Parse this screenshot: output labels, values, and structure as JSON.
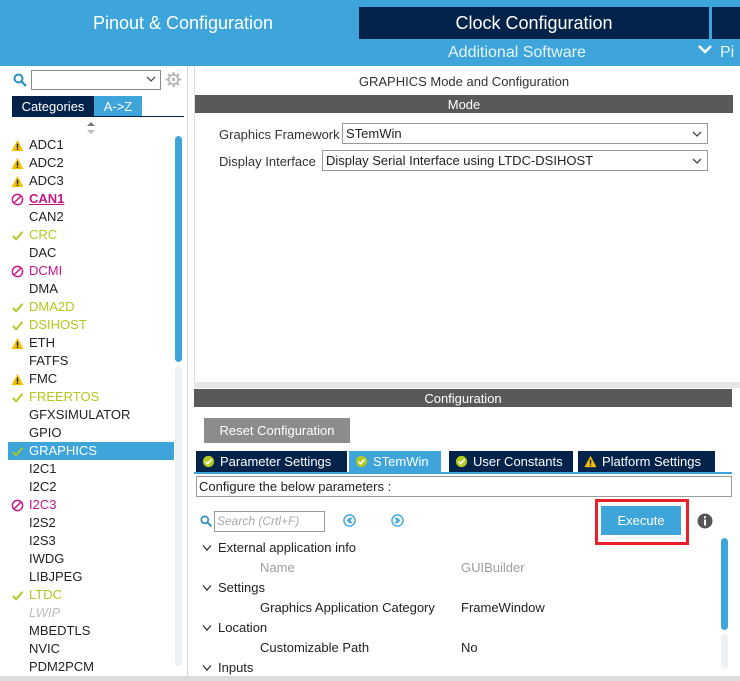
{
  "header": {
    "tab_pinout": "Pinout & Configuration",
    "tab_clock": "Clock Configuration",
    "additional_software": "Additional Software",
    "pinout_truncated": "Pi"
  },
  "sidebar": {
    "search_value": "",
    "tab_categories": "Categories",
    "tab_az": "A->Z",
    "items": [
      {
        "label": "ADC1",
        "status": "warning"
      },
      {
        "label": "ADC2",
        "status": "warning"
      },
      {
        "label": "ADC3",
        "status": "warning"
      },
      {
        "label": "CAN1",
        "status": "error"
      },
      {
        "label": "CAN2",
        "status": "none"
      },
      {
        "label": "CRC",
        "status": "ok"
      },
      {
        "label": "DAC",
        "status": "none"
      },
      {
        "label": "DCMI",
        "status": "error"
      },
      {
        "label": "DMA",
        "status": "none"
      },
      {
        "label": "DMA2D",
        "status": "ok"
      },
      {
        "label": "DSIHOST",
        "status": "ok"
      },
      {
        "label": "ETH",
        "status": "warning"
      },
      {
        "label": "FATFS",
        "status": "none"
      },
      {
        "label": "FMC",
        "status": "warning"
      },
      {
        "label": "FREERTOS",
        "status": "ok"
      },
      {
        "label": "GFXSIMULATOR",
        "status": "none"
      },
      {
        "label": "GPIO",
        "status": "none"
      },
      {
        "label": "GRAPHICS",
        "status": "selected"
      },
      {
        "label": "I2C1",
        "status": "none"
      },
      {
        "label": "I2C2",
        "status": "none"
      },
      {
        "label": "I2C3",
        "status": "error"
      },
      {
        "label": "I2S2",
        "status": "none"
      },
      {
        "label": "I2S3",
        "status": "none"
      },
      {
        "label": "IWDG",
        "status": "none"
      },
      {
        "label": "LIBJPEG",
        "status": "none"
      },
      {
        "label": "LTDC",
        "status": "ok"
      },
      {
        "label": "LWIP",
        "status": "disabled"
      },
      {
        "label": "MBEDTLS",
        "status": "none"
      },
      {
        "label": "NVIC",
        "status": "none"
      },
      {
        "label": "PDM2PCM",
        "status": "none"
      }
    ]
  },
  "mode_panel": {
    "title": "GRAPHICS Mode and Configuration",
    "section": "Mode",
    "framework_label": "Graphics Framework",
    "framework_value": "STemWin",
    "display_label": "Display Interface",
    "display_value": "Display Serial Interface using LTDC-DSIHOST"
  },
  "config_panel": {
    "section": "Configuration",
    "reset_button": "Reset Configuration",
    "tabs": [
      {
        "label": "Parameter Settings",
        "icon": "check-circle-icon"
      },
      {
        "label": "STemWin",
        "icon": "check-circle-icon"
      },
      {
        "label": "User Constants",
        "icon": "check-circle-icon"
      },
      {
        "label": "Platform Settings",
        "icon": "warning-icon"
      }
    ],
    "hint": "Configure the below parameters :",
    "search_placeholder": "Search (Crtl+F)",
    "execute_button": "Execute",
    "tree": {
      "group1": "External application info",
      "group1_name": "Name",
      "group1_value": "GUIBuilder",
      "group2": "Settings",
      "group2_name": "Graphics Application Category",
      "group2_value": "FrameWindow",
      "group3": "Location",
      "group3_name": "Customizable Path",
      "group3_value": "No",
      "group4": "Inputs"
    }
  },
  "colors": {
    "accent": "#3da5d9",
    "navy": "#03234b",
    "warning": "#f2c200",
    "ok": "#b3c81c",
    "error": "#c2188b",
    "highlight_frame": "#e8202a"
  }
}
